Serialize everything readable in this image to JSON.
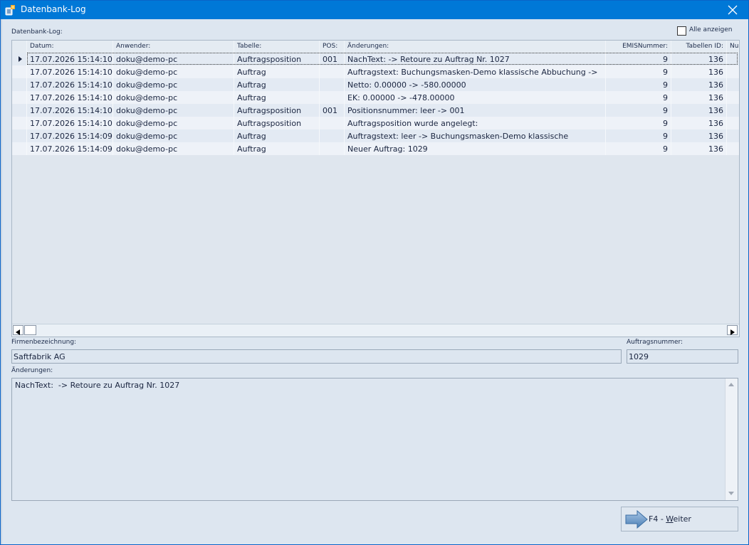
{
  "window": {
    "title": "Datenbank-Log",
    "accent_color": "#0078d7"
  },
  "labels": {
    "grid_label": "Datenbank-Log:",
    "show_all": "Alle anzeigen",
    "firm_label": "Firmenbezeichnung:",
    "order_label": "Auftragsnummer:",
    "changes_label": "Änderungen:"
  },
  "grid": {
    "columns": [
      "Datum:",
      "Anwender:",
      "Tabelle:",
      "POS:",
      "Änderungen:",
      "EMISNummer:",
      "Tabellen ID:",
      "Nu"
    ],
    "rows": [
      [
        "17.07.2026 15:14:10",
        "doku@demo-pc",
        "Auftragsposition",
        "001",
        "NachText:  -> Retoure zu Auftrag Nr. 1027",
        "9",
        "136"
      ],
      [
        "17.07.2026 15:14:10",
        "doku@demo-pc",
        "Auftrag",
        "",
        "Auftragstext: Buchungsmasken-Demo klassische Abbuchung ->",
        "9",
        "136"
      ],
      [
        "17.07.2026 15:14:10",
        "doku@demo-pc",
        "Auftrag",
        "",
        "Netto: 0.00000 -> -580.00000",
        "9",
        "136"
      ],
      [
        "17.07.2026 15:14:10",
        "doku@demo-pc",
        "Auftrag",
        "",
        "EK: 0.00000 -> -478.00000",
        "9",
        "136"
      ],
      [
        "17.07.2026 15:14:10",
        "doku@demo-pc",
        "Auftragsposition",
        "001",
        "Positionsnummer: leer -> 001",
        "9",
        "136"
      ],
      [
        "17.07.2026 15:14:10",
        "doku@demo-pc",
        "Auftragsposition",
        "",
        "Auftragsposition wurde angelegt:",
        "9",
        "136"
      ],
      [
        "17.07.2026 15:14:09",
        "doku@demo-pc",
        "Auftrag",
        "",
        "Auftragstext: leer -> Buchungsmasken-Demo klassische",
        "9",
        "136"
      ],
      [
        "17.07.2026 15:14:09",
        "doku@demo-pc",
        "Auftrag",
        "",
        "Neuer Auftrag: 1029",
        "9",
        "136"
      ]
    ],
    "selected_row": 0
  },
  "details": {
    "firm": "Saftfabrik AG",
    "order_number": "1029",
    "changes_text": "NachText:  -> Retoure zu Auftrag Nr. 1027"
  },
  "buttons": {
    "weiter_prefix": "F4 - ",
    "weiter_underlined": "W",
    "weiter_rest": "eiter"
  },
  "icons": {
    "app": "database-log-icon",
    "close": "close-icon",
    "weiter": "arrow-right-icon"
  }
}
